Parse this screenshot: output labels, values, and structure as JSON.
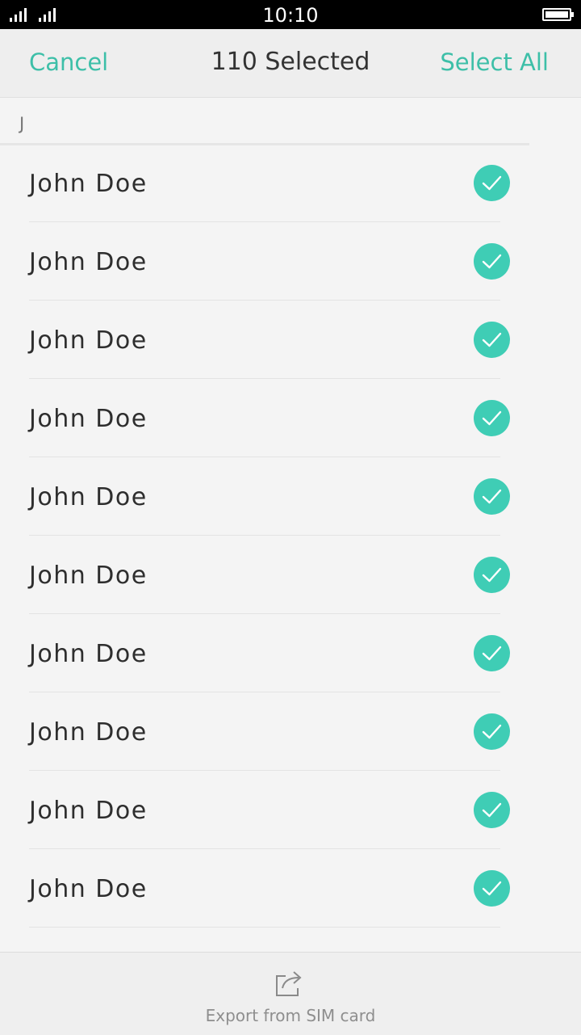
{
  "status_bar": {
    "time": "10:10"
  },
  "header": {
    "cancel_label": "Cancel",
    "title": "110 Selected",
    "select_all_label": "Select All"
  },
  "section": {
    "letter": "J"
  },
  "contacts": [
    {
      "name": "John Doe",
      "selected": true
    },
    {
      "name": "John Doe",
      "selected": true
    },
    {
      "name": "John Doe",
      "selected": true
    },
    {
      "name": "John Doe",
      "selected": true
    },
    {
      "name": "John Doe",
      "selected": true
    },
    {
      "name": "John Doe",
      "selected": true
    },
    {
      "name": "John Doe",
      "selected": true
    },
    {
      "name": "John Doe",
      "selected": true
    },
    {
      "name": "John Doe",
      "selected": true
    },
    {
      "name": "John Doe",
      "selected": true
    }
  ],
  "bottom_bar": {
    "export_label": "Export from SIM card",
    "export_icon": "share-export-icon"
  },
  "colors": {
    "accent": "#3dbfa8",
    "check_fill": "#3fcdb5"
  }
}
